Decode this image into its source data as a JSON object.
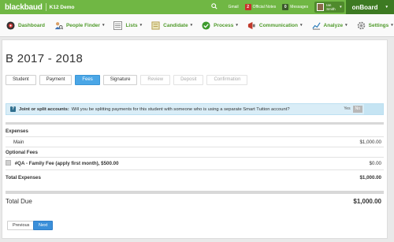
{
  "topbar": {
    "brand": "blackbaud",
    "school": "K12 Demo",
    "search_icon": "search-icon",
    "gmail_label": "Gmail",
    "official_notes_count": "2",
    "official_notes_label": "Official Notes",
    "messages_count": "0",
    "messages_label": "Messages",
    "user_first": "Ian",
    "user_last": "Smith",
    "product": "onBoard"
  },
  "nav": {
    "items": [
      {
        "label": "Dashboard",
        "icon": "dashboard-icon",
        "dropdown": false
      },
      {
        "label": "People Finder",
        "icon": "people-icon",
        "dropdown": true
      },
      {
        "label": "Lists",
        "icon": "lists-icon",
        "dropdown": true
      },
      {
        "label": "Candidate",
        "icon": "candidate-icon",
        "dropdown": true
      },
      {
        "label": "Process",
        "icon": "process-check-icon",
        "dropdown": true
      },
      {
        "label": "Communication",
        "icon": "megaphone-icon",
        "dropdown": true
      },
      {
        "label": "Analyze",
        "icon": "chart-icon",
        "dropdown": true
      },
      {
        "label": "Settings",
        "icon": "gear-icon",
        "dropdown": true
      }
    ]
  },
  "page": {
    "title": "B 2017 - 2018"
  },
  "steps": [
    {
      "label": "Student",
      "state": "normal"
    },
    {
      "label": "Payment",
      "state": "normal"
    },
    {
      "label": "Fees",
      "state": "active"
    },
    {
      "label": "Signature",
      "state": "normal"
    },
    {
      "label": "Review",
      "state": "disabled"
    },
    {
      "label": "Deposit",
      "state": "disabled"
    },
    {
      "label": "Confirmation",
      "state": "disabled"
    }
  ],
  "alert": {
    "bold": "Joint or split accounts:",
    "text": "Will you be splitting payments for this student with someone who is using a separate Smart Tuition account?",
    "yes_label": "Yes",
    "no_label": "No"
  },
  "fees": {
    "expenses_heading": "Expenses",
    "main_label": "Main",
    "main_amount": "$1,000.00",
    "optional_heading": "Optional Fees",
    "optional_item_label": "#QA - Family Fee (apply first month), $500.00",
    "optional_item_amount": "$0.00",
    "total_expenses_label": "Total Expenses",
    "total_expenses_amount": "$1,000.00",
    "total_due_label": "Total Due",
    "total_due_amount": "$1,000.00"
  },
  "buttons": {
    "previous": "Previous",
    "next": "Next"
  },
  "colors": {
    "brand_green": "#70b744",
    "active_blue": "#4aa6e6",
    "alert_bg": "#d9edf7"
  }
}
